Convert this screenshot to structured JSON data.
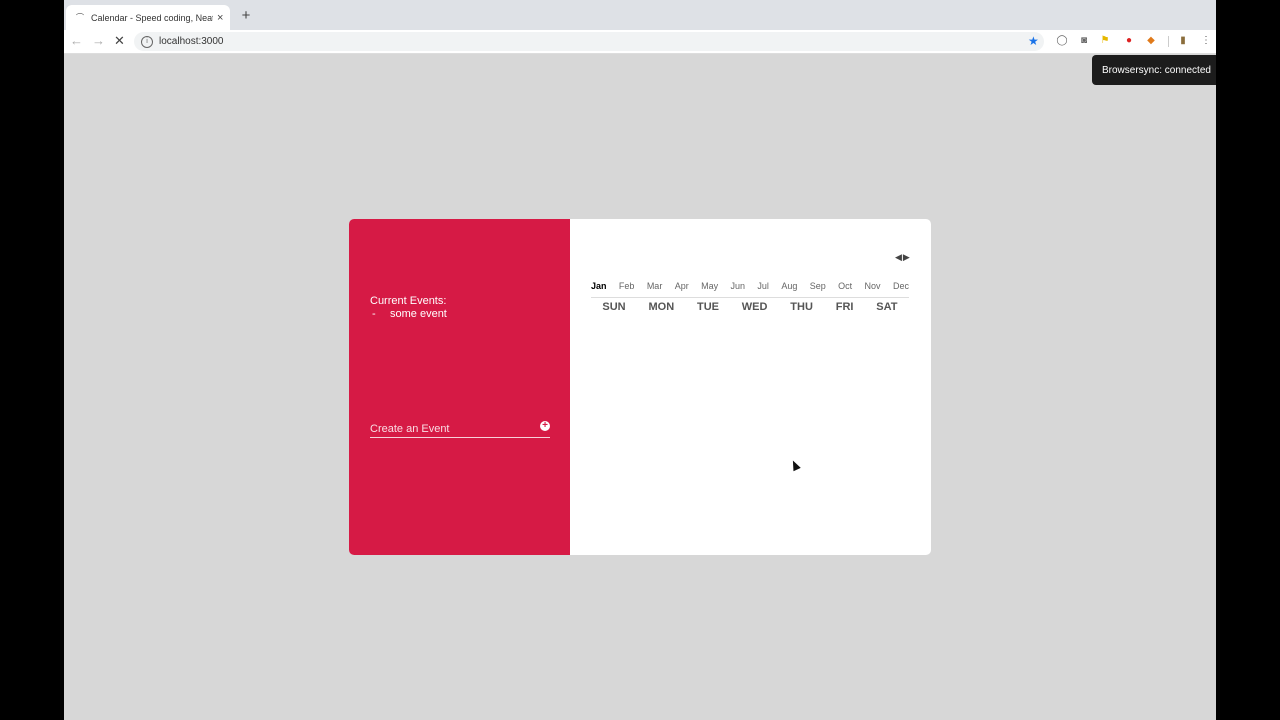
{
  "browser": {
    "tab_title": "Calendar - Speed coding, Neat",
    "tab_close": "×",
    "new_tab": "+",
    "url": "localhost:3000",
    "back": "←",
    "forward": "→",
    "reload": "✕",
    "extensions": [
      "◯",
      "◙",
      "⚑",
      "●",
      "◆",
      "▮",
      "⋮"
    ]
  },
  "toast": {
    "text": "Browsersync: connected"
  },
  "sidebar": {
    "heading": "Current Events:",
    "events": [
      {
        "bullet": "-",
        "text": "some event"
      }
    ],
    "create_placeholder": "Create an Event",
    "add_icon": "+"
  },
  "calendar": {
    "prev": "◀",
    "next": "▶",
    "months": [
      "Jan",
      "Feb",
      "Mar",
      "Apr",
      "May",
      "Jun",
      "Jul",
      "Aug",
      "Sep",
      "Oct",
      "Nov",
      "Dec"
    ],
    "active_month": "Jan",
    "weekdays": [
      "SUN",
      "MON",
      "TUE",
      "WED",
      "THU",
      "FRI",
      "SAT"
    ]
  },
  "colors": {
    "accent": "#d61a45",
    "background": "#d7d7d7"
  }
}
